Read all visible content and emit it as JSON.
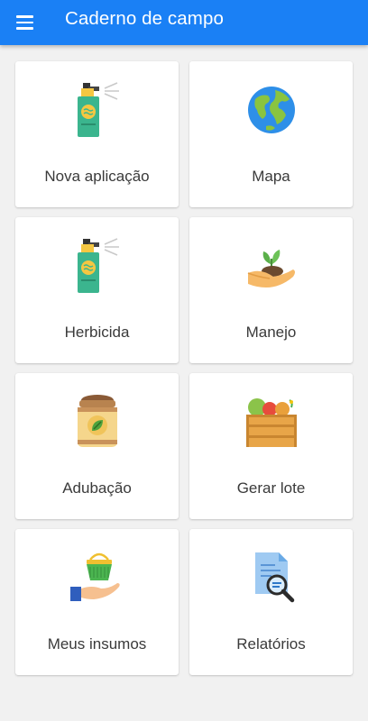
{
  "appbar": {
    "title": "Caderno de campo",
    "menu_icon": "menu-icon",
    "color": "#1a80f5"
  },
  "cards": [
    {
      "label": "Nova aplicação",
      "icon": "spray-bottle-icon"
    },
    {
      "label": "Mapa",
      "icon": "globe-icon"
    },
    {
      "label": "Herbicida",
      "icon": "spray-bottle-icon"
    },
    {
      "label": "Manejo",
      "icon": "hand-seedling-icon"
    },
    {
      "label": "Adubação",
      "icon": "fertilizer-bag-icon"
    },
    {
      "label": "Gerar lote",
      "icon": "vegetable-crate-icon"
    },
    {
      "label": "Meus insumos",
      "icon": "hand-basket-icon"
    },
    {
      "label": "Relatórios",
      "icon": "report-search-icon"
    }
  ]
}
